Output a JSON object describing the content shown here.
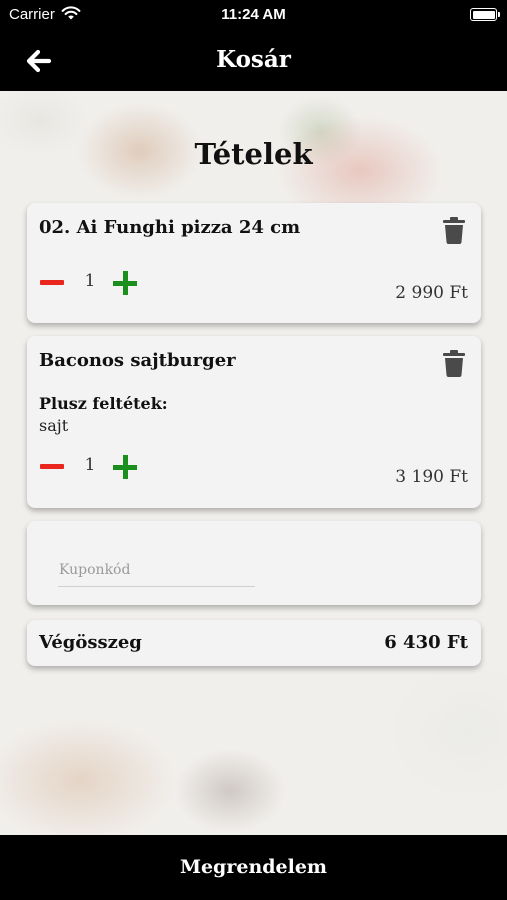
{
  "status_bar": {
    "carrier": "Carrier",
    "time": "11:24 AM",
    "battery_level": 1.0
  },
  "nav": {
    "title": "Kosár",
    "back_icon": "arrow-left-icon"
  },
  "heading": "Tételek",
  "items": [
    {
      "name": "02. Ai Funghi pizza 24 cm",
      "quantity": "1",
      "price": "2 990 Ft"
    },
    {
      "name": "Baconos sajtburger",
      "extras_label": "Plusz feltétek:",
      "extras": "sajt",
      "quantity": "1",
      "price": "3 190 Ft"
    }
  ],
  "coupon": {
    "placeholder": "Kuponkód",
    "value": ""
  },
  "total": {
    "label": "Végösszeg",
    "value": "6 430 Ft"
  },
  "order_button": "Megrendelem",
  "colors": {
    "minus": "#e8261d",
    "plus": "#1b8f1e",
    "bars": "#000000"
  }
}
